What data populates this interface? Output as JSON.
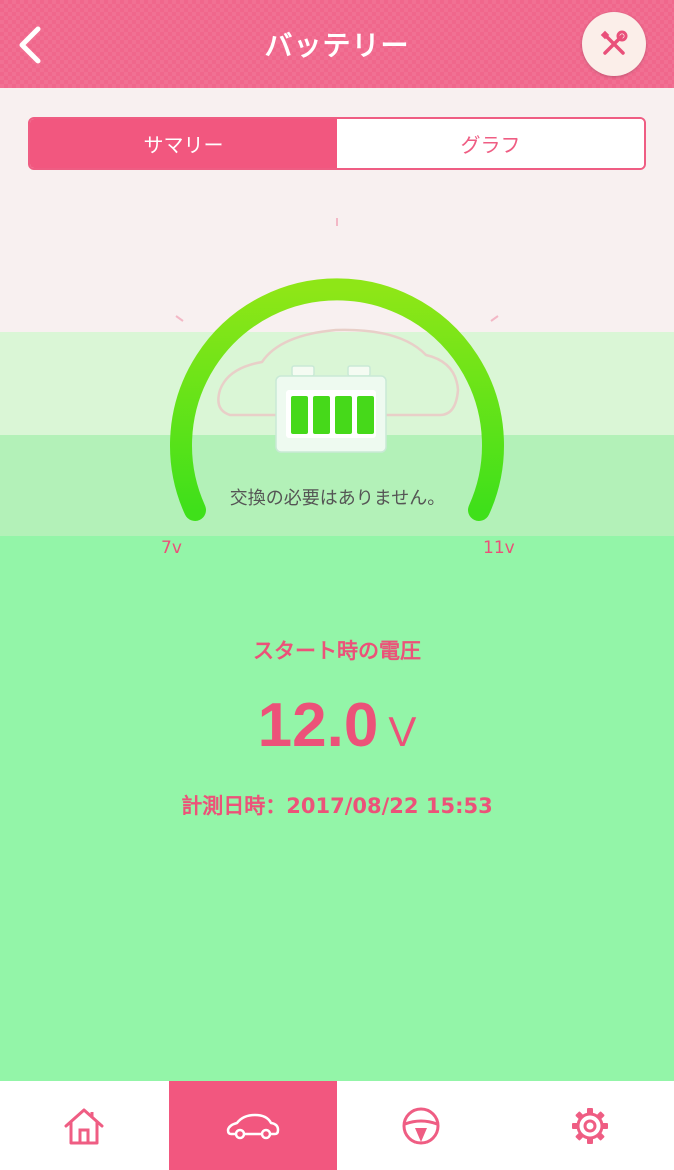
{
  "header": {
    "title": "バッテリー"
  },
  "tabs": [
    {
      "label": "サマリー",
      "active": true
    },
    {
      "label": "グラフ",
      "active": false
    }
  ],
  "gauge": {
    "min_label": "7v",
    "max_label": "11v",
    "status_message": "交換の必要はありません。",
    "arc_color": "#4ce81c"
  },
  "voltage": {
    "title": "スタート時の電圧",
    "value": "12.0",
    "unit": "V",
    "measured_at": "計測日時：2017/08/22 15:53"
  },
  "bottom_nav": [
    {
      "icon": "home-icon",
      "active": false
    },
    {
      "icon": "car-icon",
      "active": true
    },
    {
      "icon": "steering-wheel-icon",
      "active": false
    },
    {
      "icon": "gear-icon",
      "active": false
    }
  ],
  "colors": {
    "accent": "#f2577f",
    "panel_green": "#93f5a8",
    "background": "#f8f0f0"
  }
}
